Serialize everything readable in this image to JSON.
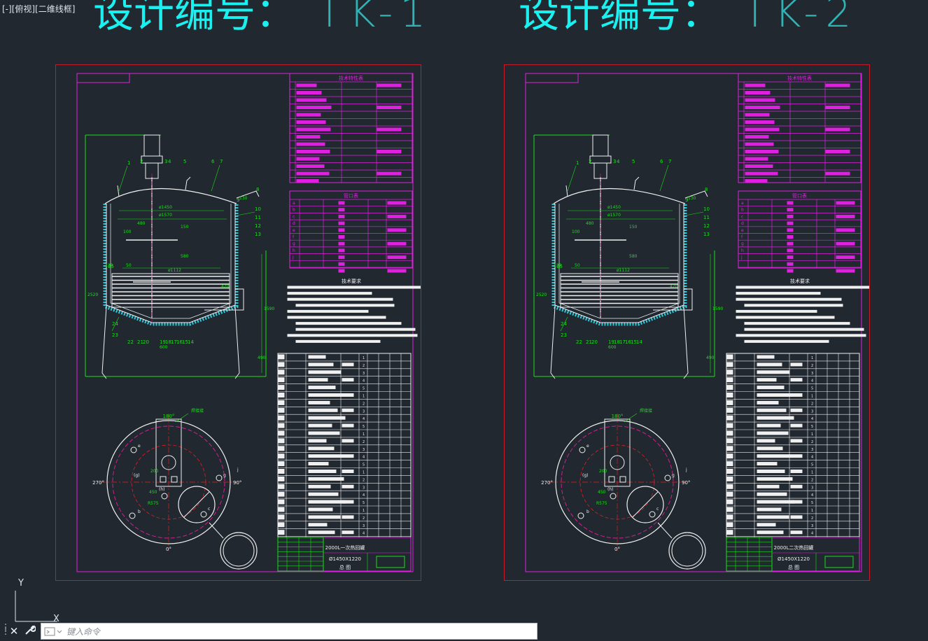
{
  "viewport": {
    "label": "[-][俯视][二维线框]"
  },
  "headings": [
    {
      "prefix": "设计编号：",
      "code": "TK-1"
    },
    {
      "prefix": "设计编号：",
      "code": "TK-2"
    }
  ],
  "sheets": [
    {
      "title": "2000L一次热回罐",
      "dims": "Ø1450X1220",
      "sub": "总 图",
      "tables": {
        "spec": "技术特性表",
        "nozzle": "管口表",
        "notes": "技术要求"
      },
      "dimensions": {
        "d1450": "ø1450",
        "d1570": "ø1570",
        "d1112": "ø1112",
        "d480": "480",
        "d100": "100",
        "d150": "150",
        "d580": "580",
        "d130": "130",
        "d50": "50",
        "d1590": "1590",
        "d600": "600",
        "d490": "490",
        "d420": "420",
        "d120": "120",
        "d2520": "2520"
      },
      "plan": {
        "a180": "180°",
        "a270": "270°",
        "a90": "90°",
        "a0": "0°",
        "d450": "450",
        "d200": "200",
        "r575": "R575",
        "note": "焊接接"
      },
      "callouts": [
        "1",
        "2",
        "3",
        "4",
        "5",
        "6",
        "7",
        "8",
        "9",
        "10",
        "11",
        "12",
        "13",
        "14",
        "15",
        "16",
        "17",
        "18",
        "19",
        "20",
        "21",
        "22",
        "23",
        "24",
        "25"
      ],
      "nozzles": [
        "a",
        "b",
        "c",
        "d",
        "e",
        "f",
        "g",
        "h",
        "j"
      ]
    },
    {
      "title": "2000L二次热回罐",
      "dims": "Ø1450X1220",
      "sub": "总 图",
      "tables": {
        "spec": "技术特性表",
        "nozzle": "管口表",
        "notes": "技术要求"
      },
      "dimensions": {
        "d1450": "ø1450",
        "d1570": "ø1570",
        "d1112": "ø1112",
        "d480": "480",
        "d100": "100",
        "d150": "150",
        "d580": "580",
        "d130": "130",
        "d50": "50",
        "d1590": "1590",
        "d600": "600",
        "d490": "490",
        "d420": "420",
        "d120": "120",
        "d2520": "2520"
      },
      "plan": {
        "a180": "180°",
        "a270": "270°",
        "a90": "90°",
        "a0": "0°",
        "d450": "450",
        "d200": "200",
        "r575": "R575",
        "note": "焊接接"
      },
      "callouts": [
        "1",
        "2",
        "3",
        "4",
        "5",
        "6",
        "7",
        "8",
        "9",
        "10",
        "11",
        "12",
        "13",
        "14",
        "15",
        "16",
        "17",
        "18",
        "19",
        "20",
        "21",
        "22",
        "23",
        "24",
        "25"
      ],
      "nozzles": [
        "a",
        "b",
        "c",
        "d",
        "e",
        "f",
        "g",
        "h",
        "j"
      ]
    }
  ],
  "ucs": {
    "y": "Y",
    "x": "X"
  },
  "commandline": {
    "placeholder": "键入命令",
    "close_icon": "close-icon",
    "customize_icon": "wrench-icon",
    "prompt_icon": "command-prompt-icon"
  },
  "colors": {
    "background": "#212830",
    "heading": "#19f0ef",
    "sheet_border": "#c81b2a",
    "title_frame": "#e020e0",
    "dimension": "#18e018",
    "geometry": "#f0f0f0",
    "insulation": "#30c8d8",
    "centerline": "#d02090"
  }
}
